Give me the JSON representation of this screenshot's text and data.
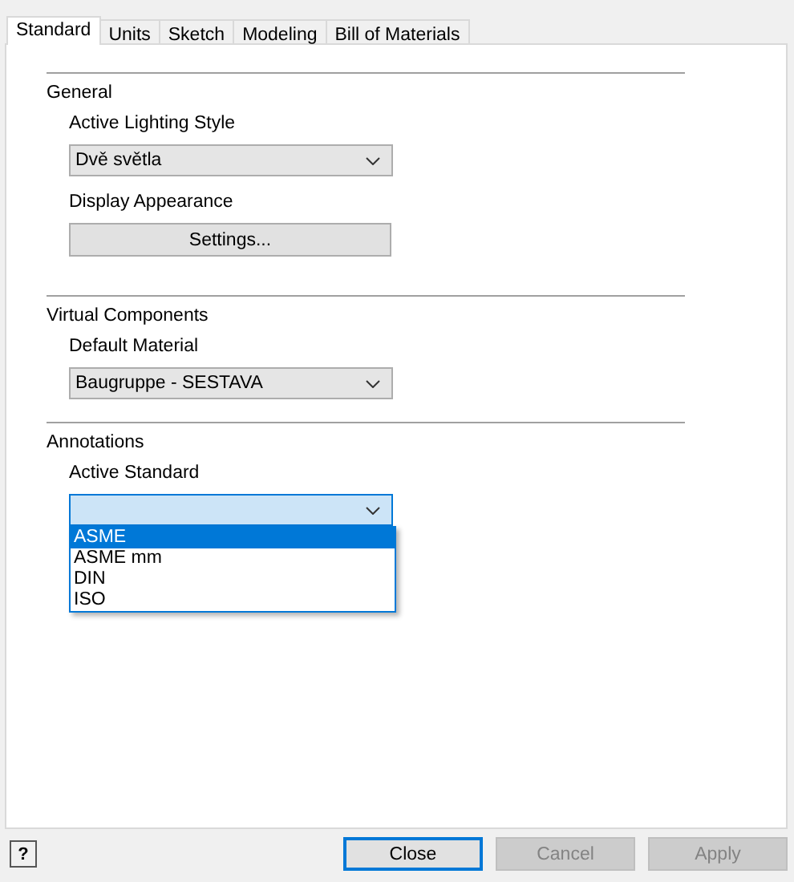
{
  "tabs": [
    {
      "label": "Standard",
      "selected": true
    },
    {
      "label": "Units",
      "selected": false
    },
    {
      "label": "Sketch",
      "selected": false
    },
    {
      "label": "Modeling",
      "selected": false
    },
    {
      "label": "Bill of Materials",
      "selected": false
    }
  ],
  "sections": [
    {
      "title": "General",
      "fields": [
        {
          "kind": "combo",
          "label": "Active Lighting Style",
          "value": "Dvě světla",
          "expanded": false
        },
        {
          "kind": "button",
          "label": "Display Appearance",
          "button": "Settings..."
        }
      ]
    },
    {
      "title": "Virtual Components",
      "fields": [
        {
          "kind": "combo",
          "label": "Default Material",
          "value": "Baugruppe - SESTAVA",
          "expanded": false
        }
      ]
    },
    {
      "title": "Annotations",
      "fields": [
        {
          "kind": "combo",
          "label": "Active Standard",
          "expanded": true,
          "options": [
            {
              "label": "ASME",
              "selected": true
            },
            {
              "label": "ASME mm",
              "selected": false
            },
            {
              "label": "DIN",
              "selected": false
            },
            {
              "label": "ISO",
              "selected": false
            }
          ]
        }
      ]
    }
  ],
  "help_button": "?",
  "buttons": [
    {
      "label": "Close",
      "disabled": false,
      "default": true
    },
    {
      "label": "Cancel",
      "disabled": true,
      "default": false
    },
    {
      "label": "Apply",
      "disabled": true,
      "default": false
    }
  ]
}
